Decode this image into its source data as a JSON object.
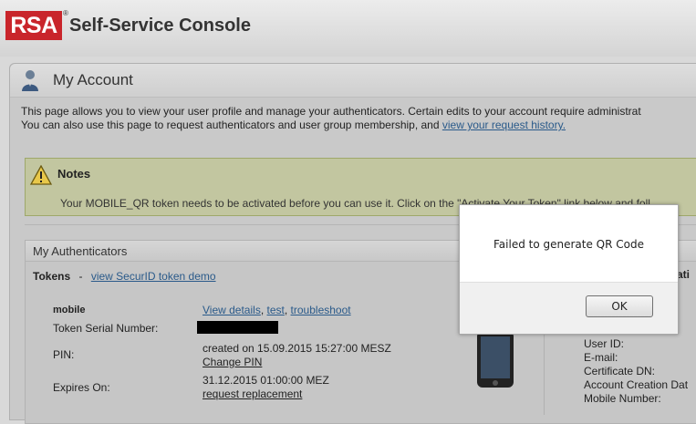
{
  "header": {
    "logo_text": "RSA",
    "logo_reg": "®",
    "app_title": "Self-Service Console"
  },
  "page": {
    "title": "My Account",
    "intro_line1": "This page allows you to view your user profile and manage your authenticators. Certain edits to your account require administrat",
    "intro_line2_prefix": "You can also use this page to request authenticators and user group membership, and ",
    "intro_link": "view your request history."
  },
  "notes": {
    "title": "Notes",
    "text": "Your MOBILE_QR token needs to be activated before you can use it. Click on the \"Activate Your Token\" link below and foll"
  },
  "authenticators": {
    "title": "My Authenticators",
    "tokens_label": "Tokens",
    "tokens_sep": "-",
    "demo_link": "view SecurID token demo",
    "token_name": "mobile",
    "links": {
      "details": "View details",
      "comma1": ",",
      "test": "test",
      "comma2": ",",
      "troubleshoot": "troubleshoot"
    },
    "rows": {
      "serial_label": "Token Serial Number:",
      "pin_label": "PIN:",
      "pin_created": "created on 15.09.2015 15:27:00 MESZ",
      "change_pin": "Change PIN",
      "expires_label": "Expires On:",
      "expires_value": "31.12.2015 01:00:00 MEZ",
      "request_replacement": "request replacement"
    },
    "right_partial": {
      "heading_fragment": "ati",
      "user_id": "User ID:",
      "email": "E-mail:",
      "cert_dn": "Certificate DN:",
      "creation": "Account Creation Dat",
      "mobile": "Mobile Number:"
    }
  },
  "dialog": {
    "message": "Failed to generate QR Code",
    "ok_label": "OK"
  }
}
